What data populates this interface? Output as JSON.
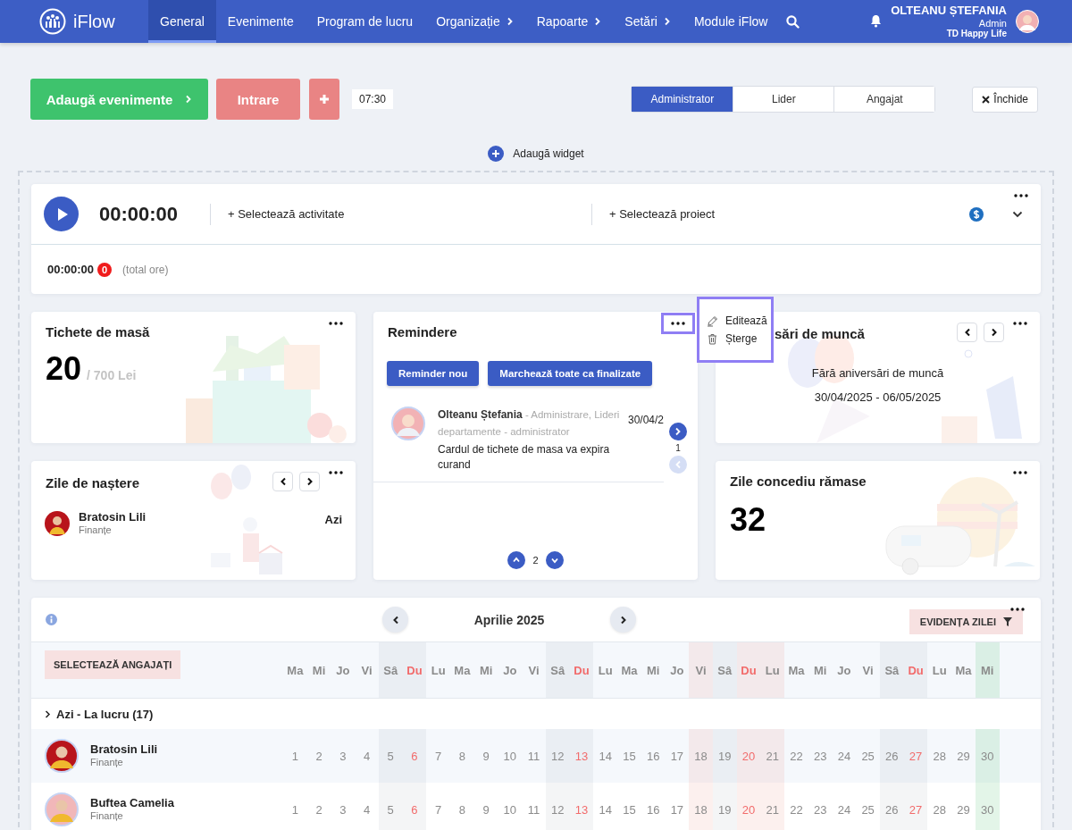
{
  "nav": {
    "logo": "iFlow",
    "items": [
      {
        "label": "General",
        "selected": true,
        "submenu": false
      },
      {
        "label": "Evenimente",
        "selected": false,
        "submenu": false
      },
      {
        "label": "Program de lucru",
        "selected": false,
        "submenu": false
      },
      {
        "label": "Organizație",
        "selected": false,
        "submenu": true
      },
      {
        "label": "Rapoarte",
        "selected": false,
        "submenu": true
      },
      {
        "label": "Setări",
        "selected": false,
        "submenu": true
      },
      {
        "label": "Module iFlow",
        "selected": false,
        "submenu": false
      }
    ],
    "user": {
      "name": "OLTEANU ȘTEFANIA",
      "role": "Admin",
      "company": "TD Happy Life"
    }
  },
  "toolbar": {
    "add_events": "Adaugă evenimente",
    "check_in": "Intrare",
    "time": "07:30",
    "roles": [
      {
        "label": "Administrator",
        "selected": true
      },
      {
        "label": "Lider",
        "selected": false
      },
      {
        "label": "Angajat",
        "selected": false
      }
    ],
    "close": "Închide"
  },
  "add_widget": "Adaugă widget",
  "timer": {
    "time": "00:00:00",
    "activity": "+ Selectează activitate",
    "project": "+ Selectează proiect",
    "total": "00:00:00",
    "count": "0",
    "total_label": "(total ore)"
  },
  "meal_tickets": {
    "title": "Tichete de masă",
    "value": "20",
    "of": "/ 700 Lei"
  },
  "reminders": {
    "title": "Remindere",
    "buttons": [
      "Reminder nou",
      "Marchează toate ca finalizate"
    ],
    "items": [
      {
        "name": "Olteanu Ștefania",
        "meta": "- Administrare, Lideri departamente - administrator",
        "date": "30/04/2",
        "text": "Cardul de tichete de masa va expira curand"
      }
    ],
    "item_page": "1",
    "page": "2"
  },
  "menu": {
    "items": [
      {
        "kind": "edit",
        "label": "Editează"
      },
      {
        "kind": "delete",
        "label": "Șterge"
      }
    ]
  },
  "birthdays": {
    "title": "Zile de naștere",
    "people": [
      {
        "name": "Bratosin Lili",
        "department": "Finanțe",
        "when": "Azi"
      }
    ]
  },
  "anniversaries": {
    "title": "sări de muncă",
    "message": "Fără aniversări de muncă",
    "range": "30/04/2025 - 06/05/2025"
  },
  "leave": {
    "title": "Zile concediu rămase",
    "value": "32"
  },
  "calendar": {
    "month": "Aprilie 2025",
    "filter": "EVIDENȚA ZILEI",
    "select": "SELECTEAZĂ ANGAJAȚI",
    "group": "Azi - La lucru (17)",
    "days": [
      {
        "label": "Ma",
        "kind": "work"
      },
      {
        "label": "Mi",
        "kind": "work"
      },
      {
        "label": "Jo",
        "kind": "work"
      },
      {
        "label": "Vi",
        "kind": "work"
      },
      {
        "label": "Sâ",
        "kind": "saturday"
      },
      {
        "label": "Du",
        "kind": "sunday"
      },
      {
        "label": "Lu",
        "kind": "work"
      },
      {
        "label": "Ma",
        "kind": "work"
      },
      {
        "label": "Mi",
        "kind": "work"
      },
      {
        "label": "Jo",
        "kind": "work"
      },
      {
        "label": "Vi",
        "kind": "work"
      },
      {
        "label": "Sâ",
        "kind": "saturday"
      },
      {
        "label": "Du",
        "kind": "sunday"
      },
      {
        "label": "Lu",
        "kind": "work"
      },
      {
        "label": "Ma",
        "kind": "work"
      },
      {
        "label": "Mi",
        "kind": "work"
      },
      {
        "label": "Jo",
        "kind": "work"
      },
      {
        "label": "Vi",
        "kind": "holiday"
      },
      {
        "label": "Sâ",
        "kind": "saturday"
      },
      {
        "label": "Du",
        "kind": "holiday_sunday"
      },
      {
        "label": "Lu",
        "kind": "holiday"
      },
      {
        "label": "Ma",
        "kind": "work"
      },
      {
        "label": "Mi",
        "kind": "work"
      },
      {
        "label": "Jo",
        "kind": "work"
      },
      {
        "label": "Vi",
        "kind": "work"
      },
      {
        "label": "Sâ",
        "kind": "saturday"
      },
      {
        "label": "Du",
        "kind": "sunday"
      },
      {
        "label": "Lu",
        "kind": "work"
      },
      {
        "label": "Ma",
        "kind": "work"
      },
      {
        "label": "Mi",
        "kind": "today"
      }
    ],
    "employees": [
      {
        "name": "Bratosin Lili",
        "department": "Finanțe",
        "numbers": [
          "1",
          "2",
          "3",
          "4",
          "5",
          "6",
          "7",
          "8",
          "9",
          "10",
          "11",
          "12",
          "13",
          "14",
          "15",
          "16",
          "17",
          "18",
          "19",
          "20",
          "21",
          "22",
          "23",
          "24",
          "25",
          "26",
          "27",
          "28",
          "29",
          "30"
        ]
      },
      {
        "name": "Buftea Camelia",
        "department": "Finanțe",
        "numbers": [
          "1",
          "2",
          "3",
          "4",
          "5",
          "6",
          "7",
          "8",
          "9",
          "10",
          "11",
          "12",
          "13",
          "14",
          "15",
          "16",
          "17",
          "18",
          "19",
          "20",
          "21",
          "22",
          "23",
          "24",
          "25",
          "26",
          "27",
          "28",
          "29",
          "30"
        ]
      }
    ]
  }
}
